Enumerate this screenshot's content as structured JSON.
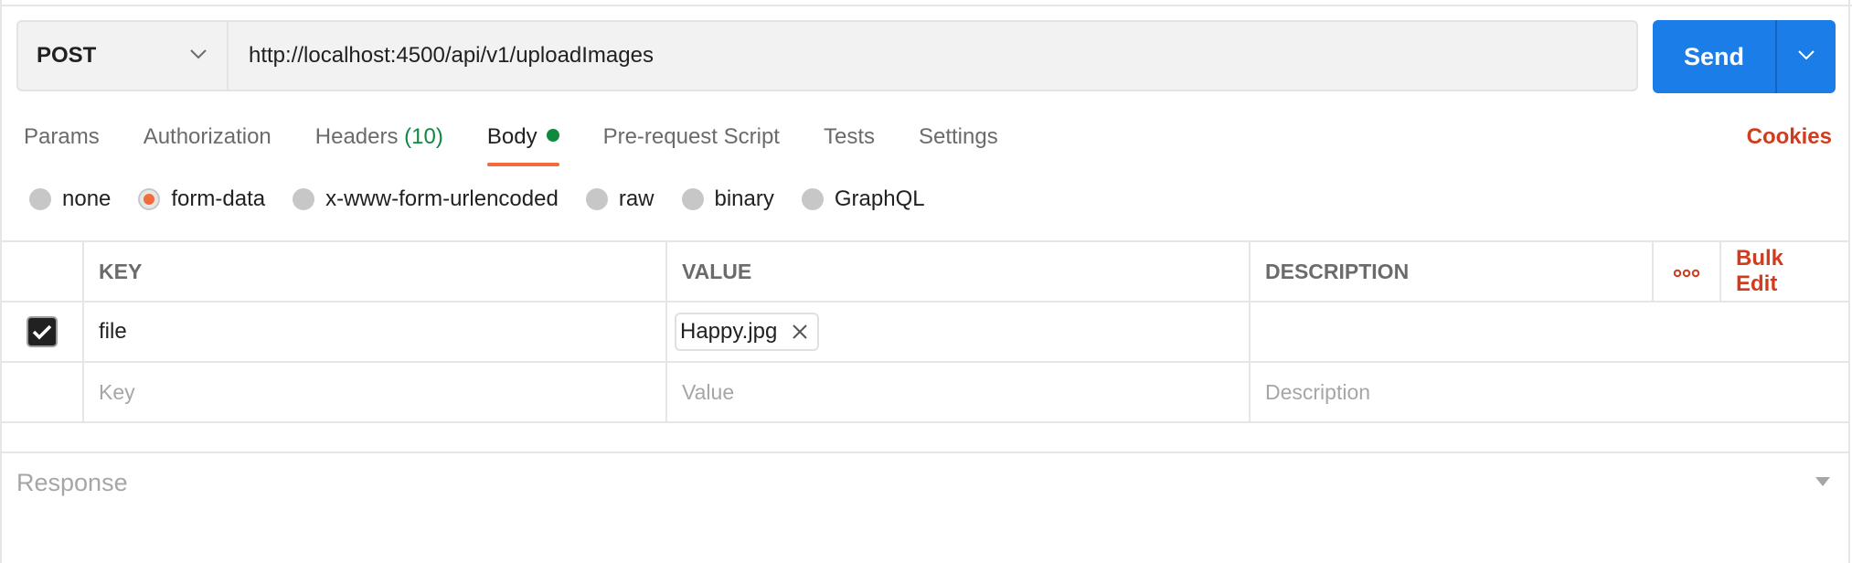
{
  "request": {
    "method": "POST",
    "url": "http://localhost:4500/api/v1/uploadImages",
    "send_label": "Send"
  },
  "tabs": [
    {
      "label": "Params"
    },
    {
      "label": "Authorization"
    },
    {
      "label": "Headers",
      "count": "(10)"
    },
    {
      "label": "Body",
      "active": true,
      "indicator": "modified"
    },
    {
      "label": "Pre-request Script"
    },
    {
      "label": "Tests"
    },
    {
      "label": "Settings"
    }
  ],
  "cookies_label": "Cookies",
  "body_modes": [
    {
      "label": "none",
      "checked": false
    },
    {
      "label": "form-data",
      "checked": true
    },
    {
      "label": "x-www-form-urlencoded",
      "checked": false
    },
    {
      "label": "raw",
      "checked": false
    },
    {
      "label": "binary",
      "checked": false
    },
    {
      "label": "GraphQL",
      "checked": false
    }
  ],
  "table": {
    "headers": {
      "key": "KEY",
      "value": "VALUE",
      "description": "DESCRIPTION",
      "bulk_edit": "Bulk Edit"
    },
    "rows": [
      {
        "checked": true,
        "key": "file",
        "value_file": "Happy.jpg",
        "description": ""
      }
    ],
    "placeholders": {
      "key": "Key",
      "value": "Value",
      "description": "Description"
    }
  },
  "response": {
    "label": "Response"
  },
  "colors": {
    "accent": "#f26b3a",
    "send": "#1a7de8",
    "link_red": "#d23c1e",
    "status_green": "#0d8a3f"
  },
  "icons": [
    "chevron-down-icon",
    "close-icon",
    "checkmark-icon",
    "more-horizontal-icon"
  ]
}
